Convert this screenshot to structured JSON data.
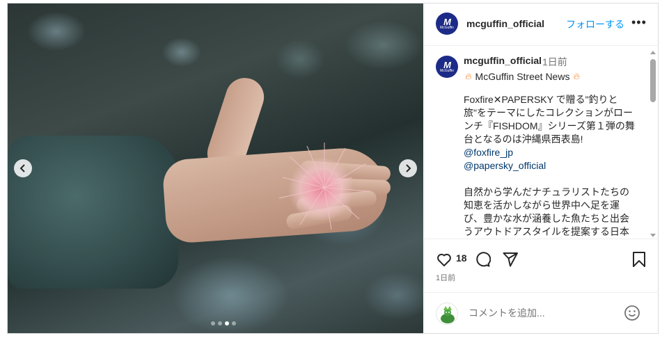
{
  "post": {
    "username": "mcguffin_official",
    "follow_label": "フォローする",
    "more_label": "•••",
    "avatar_logo": "McGuffin",
    "media": {
      "prev_icon": "chevron-left-icon",
      "next_icon": "chevron-right-icon",
      "slide_count": 4,
      "active_slide": 3
    }
  },
  "caption": {
    "username": "mcguffin_official",
    "time": "1日前",
    "title_icon": "fire-icon",
    "title": "McGuffin Street News",
    "paragraph1": "Foxfire✕PAPERSKY で贈る\"釣りと旅\"をテーマにしたコレクションがローンチ『FISHDOM』シリーズ第１弾の舞台となるのは沖縄県西表島!",
    "mentions": [
      "@foxfire_jp",
      "@papersky_official"
    ],
    "paragraph2": "自然から学んだナチュラリストたちの知恵を活かしながら世界中へ足を運び、豊かな水が涵養した魚たちと出会うアウトドアスタイルを提案する日本生まれのアウトドアブランド《Foxfire(フォックスファイヤー)》。"
  },
  "actions": {
    "like_icon": "heart-icon",
    "like_count": "18",
    "comment_icon": "comment-icon",
    "share_icon": "send-icon",
    "save_icon": "bookmark-icon",
    "post_time": "1日前"
  },
  "comment": {
    "placeholder": "コメントを追加...",
    "avatar_icon": "user-avatar-icon",
    "emoji_icon": "emoji-icon"
  },
  "colors": {
    "accent": "#0095f6",
    "text": "#262626",
    "muted": "#737373",
    "avatar_bg": "#1d2b88",
    "fire": "#f28b30",
    "link": "#00376b"
  }
}
